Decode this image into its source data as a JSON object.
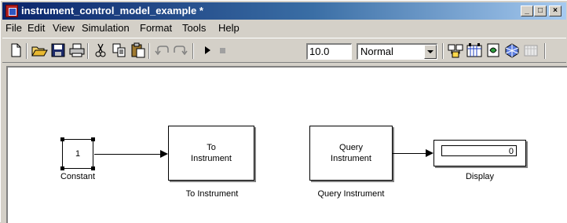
{
  "window": {
    "title": "instrument_control_model_example *",
    "controls": {
      "minimize": "_",
      "maximize": "□",
      "close": "×"
    }
  },
  "menu": [
    "File",
    "Edit",
    "View",
    "Simulation",
    "Format",
    "Tools",
    "Help"
  ],
  "toolbar": {
    "buttons": [
      "new-icon",
      "open-icon",
      "save-icon",
      "print-icon",
      "cut-icon",
      "copy-icon",
      "paste-icon",
      "undo-icon",
      "redo-icon",
      "start-simulation-icon",
      "stop-simulation-icon",
      "build-icon",
      "update-diagram-icon",
      "library-browser-icon",
      "model-explorer-icon",
      "debugger-icon"
    ],
    "stop_time": "10.0",
    "simulation_mode": "Normal"
  },
  "blocks": {
    "constant": {
      "value": "1",
      "label": "Constant"
    },
    "to_instrument": {
      "text_line1": "To",
      "text_line2": "Instrument",
      "label": "To Instrument"
    },
    "query_instrument": {
      "text_line1": "Query",
      "text_line2": "Instrument",
      "label": "Query Instrument"
    },
    "display": {
      "value": "0",
      "label": "Display"
    }
  },
  "colors": {
    "titlebar_start": "#0a246a",
    "titlebar_end": "#a6caf0",
    "chrome": "#d4d0c8",
    "canvas": "#ffffff"
  }
}
